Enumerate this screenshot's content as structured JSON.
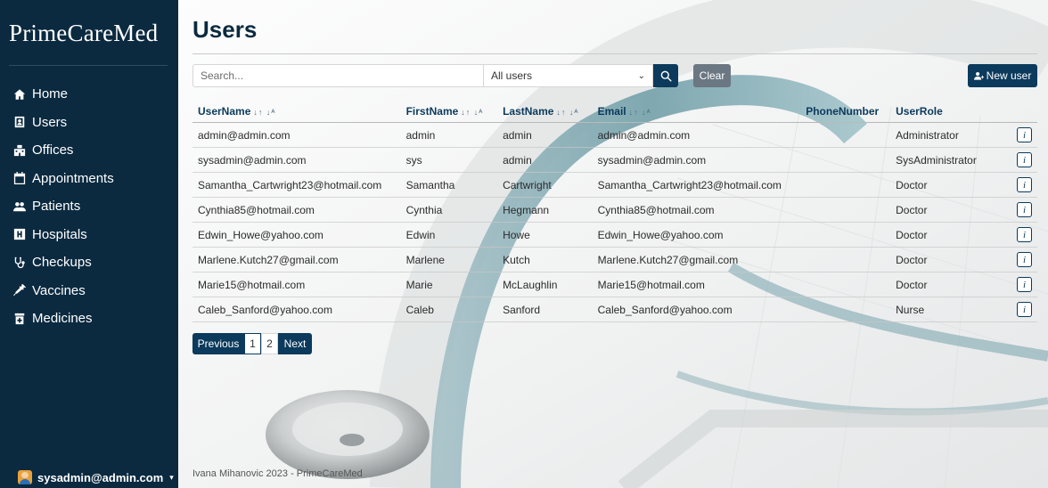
{
  "brand": "PrimeCareMed",
  "sidebar": {
    "items": [
      {
        "label": "Home",
        "icon": "home-icon"
      },
      {
        "label": "Users",
        "icon": "id-card-icon"
      },
      {
        "label": "Offices",
        "icon": "office-building-icon"
      },
      {
        "label": "Appointments",
        "icon": "calendar-icon"
      },
      {
        "label": "Patients",
        "icon": "people-icon"
      },
      {
        "label": "Hospitals",
        "icon": "hospital-icon"
      },
      {
        "label": "Checkups",
        "icon": "stethoscope-icon"
      },
      {
        "label": "Vaccines",
        "icon": "syringe-icon"
      },
      {
        "label": "Medicines",
        "icon": "medicine-icon"
      }
    ],
    "current_user": "sysadmin@admin.com"
  },
  "page": {
    "title": "Users"
  },
  "toolbar": {
    "search_placeholder": "Search...",
    "filter_value": "All users",
    "clear_label": "Clear",
    "new_user_label": "New user"
  },
  "table": {
    "headers": {
      "username": "UserName",
      "firstname": "FirstName",
      "lastname": "LastName",
      "email": "Email",
      "phone": "PhoneNumber",
      "role": "UserRole"
    },
    "sort_glyph": "↓↑ ↓ᴬ",
    "rows": [
      {
        "username": "admin@admin.com",
        "firstname": "admin",
        "lastname": "admin",
        "email": "admin@admin.com",
        "phone": "",
        "role": "Administrator"
      },
      {
        "username": "sysadmin@admin.com",
        "firstname": "sys",
        "lastname": "admin",
        "email": "sysadmin@admin.com",
        "phone": "",
        "role": "SysAdministrator"
      },
      {
        "username": "Samantha_Cartwright23@hotmail.com",
        "firstname": "Samantha",
        "lastname": "Cartwright",
        "email": "Samantha_Cartwright23@hotmail.com",
        "phone": "",
        "role": "Doctor"
      },
      {
        "username": "Cynthia85@hotmail.com",
        "firstname": "Cynthia",
        "lastname": "Hegmann",
        "email": "Cynthia85@hotmail.com",
        "phone": "",
        "role": "Doctor"
      },
      {
        "username": "Edwin_Howe@yahoo.com",
        "firstname": "Edwin",
        "lastname": "Howe",
        "email": "Edwin_Howe@yahoo.com",
        "phone": "",
        "role": "Doctor"
      },
      {
        "username": "Marlene.Kutch27@gmail.com",
        "firstname": "Marlene",
        "lastname": "Kutch",
        "email": "Marlene.Kutch27@gmail.com",
        "phone": "",
        "role": "Doctor"
      },
      {
        "username": "Marie15@hotmail.com",
        "firstname": "Marie",
        "lastname": "McLaughlin",
        "email": "Marie15@hotmail.com",
        "phone": "",
        "role": "Doctor"
      },
      {
        "username": "Caleb_Sanford@yahoo.com",
        "firstname": "Caleb",
        "lastname": "Sanford",
        "email": "Caleb_Sanford@yahoo.com",
        "phone": "",
        "role": "Nurse"
      }
    ],
    "info_label": "i"
  },
  "pagination": {
    "prev_label": "Previous",
    "pages": [
      "1",
      "2"
    ],
    "active_page": "1",
    "next_label": "Next"
  },
  "footer": {
    "text": "Ivana Mihanovic 2023 - PrimeCareMed"
  },
  "colors": {
    "sidebar_bg": "#0b2a40",
    "primary": "#0b3a5c",
    "clear_btn": "#6b7782"
  }
}
